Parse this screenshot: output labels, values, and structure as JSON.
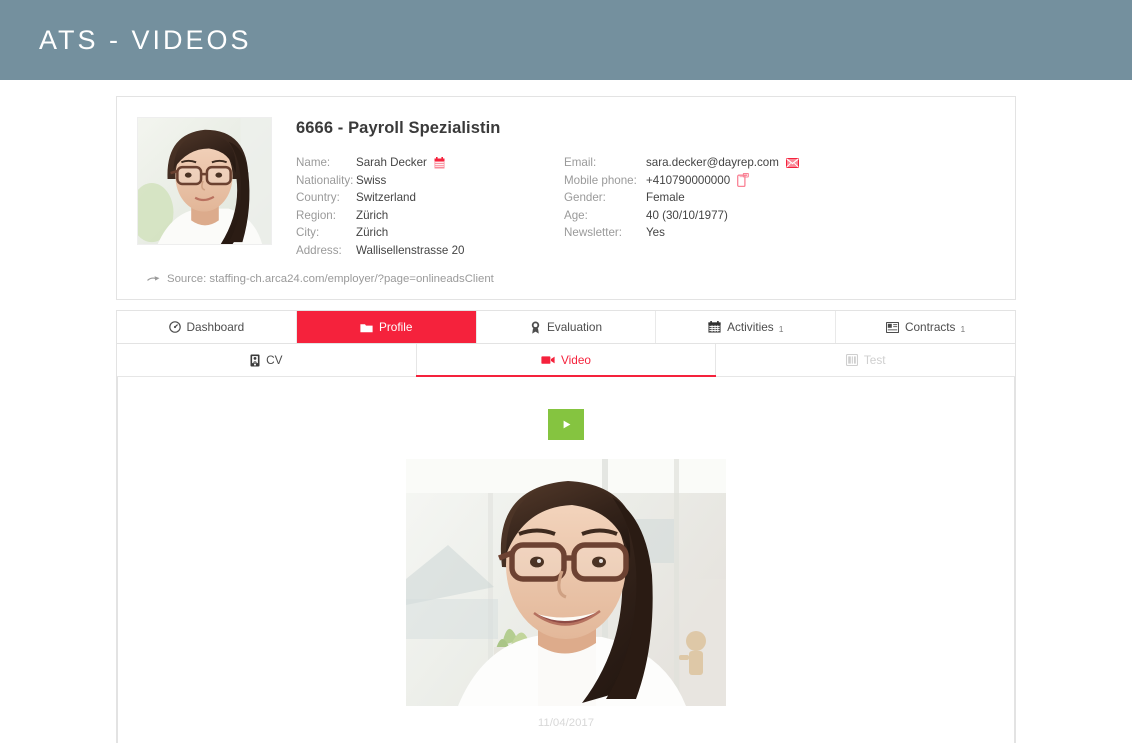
{
  "header": {
    "title": "ATS - VIDEOS",
    "background_color": "#74909e"
  },
  "theme": {
    "accent_red": "#f5223c",
    "play_green": "#85c440",
    "label_gray": "#9a9a9a"
  },
  "candidate": {
    "title": "6666 - Payroll Spezialistin",
    "photo_alt": "candidate-portrait",
    "fields_left": [
      {
        "label": "Name:",
        "value": "Sarah Decker",
        "icon": "calendar-icon"
      },
      {
        "label": "Nationality:",
        "value": "Swiss",
        "icon": ""
      },
      {
        "label": "Country:",
        "value": "Switzerland",
        "icon": ""
      },
      {
        "label": "Region:",
        "value": "Zürich",
        "icon": ""
      },
      {
        "label": "City:",
        "value": "Zürich",
        "icon": ""
      },
      {
        "label": "Address:",
        "value": "Wallisellenstrasse 20",
        "icon": ""
      }
    ],
    "fields_right": [
      {
        "label": "Email:",
        "value": "sara.decker@dayrep.com",
        "icon": "envelope-icon"
      },
      {
        "label": "Mobile phone:",
        "value": "+410790000000",
        "icon": "mobile-phone-icon"
      },
      {
        "label": "Gender:",
        "value": "Female",
        "icon": ""
      },
      {
        "label": "Age:",
        "value": "40 (30/10/1977)",
        "icon": ""
      },
      {
        "label": "Newsletter:",
        "value": "Yes",
        "icon": ""
      }
    ],
    "source": {
      "icon": "arrow-right-icon",
      "label": "Source:",
      "url": "staffing-ch.arca24.com/employer/?page=onlineadsClient",
      "full_text": "Source: staffing-ch.arca24.com/employer/?page=onlineadsClient"
    }
  },
  "tabs_primary": [
    {
      "label": "Dashboard",
      "icon": "dashboard-icon",
      "count": "",
      "active": false
    },
    {
      "label": "Profile",
      "icon": "folder-icon",
      "count": "",
      "active": true
    },
    {
      "label": "Evaluation",
      "icon": "award-icon",
      "count": "",
      "active": false
    },
    {
      "label": "Activities",
      "icon": "calendar-icon",
      "count": "1",
      "active": false
    },
    {
      "label": "Contracts",
      "icon": "contract-icon",
      "count": "1",
      "active": false
    }
  ],
  "tabs_secondary": [
    {
      "label": "CV",
      "icon": "cv-document-icon",
      "active": false,
      "disabled": false
    },
    {
      "label": "Video",
      "icon": "video-camera-icon",
      "active": true,
      "disabled": false
    },
    {
      "label": "Test",
      "icon": "test-icon",
      "active": false,
      "disabled": true
    }
  ],
  "video_panel": {
    "play_button_icon": "play-icon",
    "thumbnail_alt": "video-thumbnail-candidate",
    "date": "11/04/2017"
  }
}
